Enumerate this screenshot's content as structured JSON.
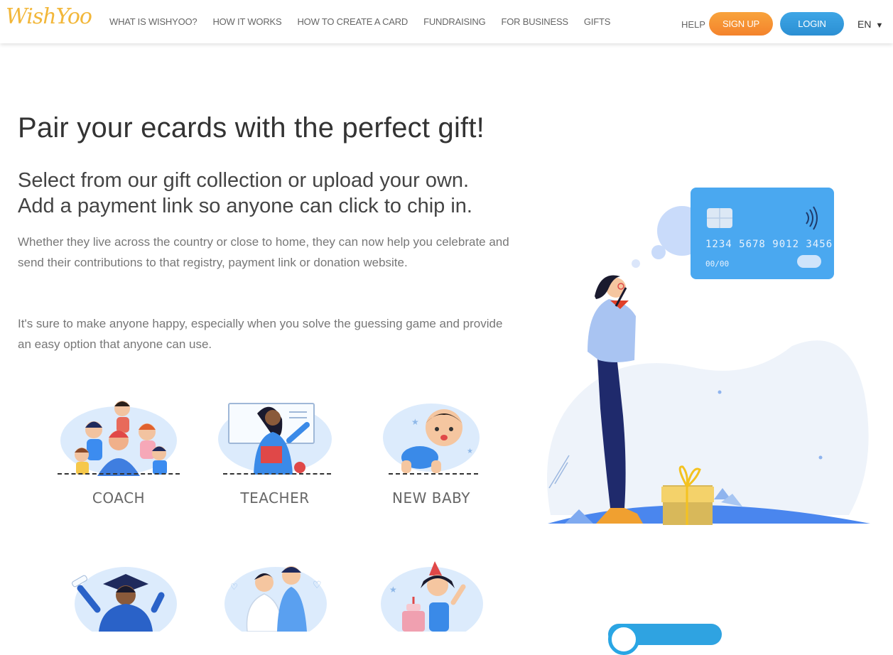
{
  "header": {
    "logo": "WishYoo",
    "nav": [
      {
        "label": "WHAT IS WISHYOO?"
      },
      {
        "label": "HOW IT WORKS"
      },
      {
        "label": "HOW TO CREATE A CARD"
      },
      {
        "label": "FUNDRAISING"
      },
      {
        "label": "FOR BUSINESS"
      },
      {
        "label": "GIFTS"
      }
    ],
    "help": "HELP",
    "signup": "SIGN UP",
    "login": "LOGIN",
    "language": "EN"
  },
  "main": {
    "title": "Pair your ecards with the perfect gift!",
    "subtitle_line1": "Select from our gift collection or upload your own.",
    "subtitle_line2": "Add a payment link so anyone can click to chip in.",
    "paragraph1": "Whether they live across the country or close to home, they can now help you celebrate and send their contributions to that registry, payment link or donation website.",
    "paragraph2": "It's sure to make anyone happy, especially when you solve the guessing game and provide an easy option that anyone can use."
  },
  "categories": [
    {
      "label": "COACH",
      "icon": "coach-illustration"
    },
    {
      "label": "TEACHER",
      "icon": "teacher-illustration"
    },
    {
      "label": "NEW BABY",
      "icon": "new-baby-illustration"
    },
    {
      "label": "",
      "icon": "graduation-illustration"
    },
    {
      "label": "",
      "icon": "wedding-illustration"
    },
    {
      "label": "",
      "icon": "birthday-illustration"
    }
  ],
  "hero": {
    "card_number": "1234 5678 9012 3456",
    "card_expiry": "00/00"
  },
  "colors": {
    "accent_orange": "#f4832c",
    "accent_blue": "#2b8fd3",
    "logo_yellow": "#f2b73a",
    "card_blue": "#4aa8f0"
  }
}
